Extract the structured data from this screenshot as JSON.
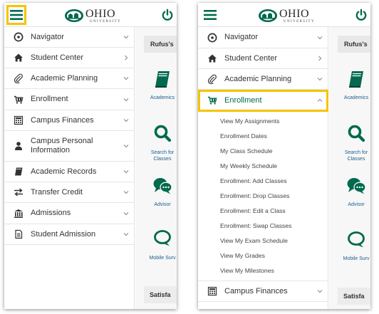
{
  "colors": {
    "brand_green": "#00694e",
    "highlight": "#f5c400",
    "link_blue": "#1b5d8f",
    "text": "#333333"
  },
  "header": {
    "logo_text": "OHIO",
    "logo_subtext": "UNIVERSITY",
    "menu_icon": "hamburger-icon",
    "power_icon": "power-icon"
  },
  "left_panel": {
    "menu": [
      {
        "label": "Navigator",
        "icon": "compass-icon",
        "chevron": "down"
      },
      {
        "label": "Student Center",
        "icon": "home-icon",
        "chevron": "right"
      },
      {
        "label": "Academic Planning",
        "icon": "paperclip-icon",
        "chevron": "down"
      },
      {
        "label": "Enrollment",
        "icon": "cart-icon",
        "chevron": "down"
      },
      {
        "label": "Campus Finances",
        "icon": "calculator-icon",
        "chevron": "down"
      },
      {
        "label_line1": "Campus Personal",
        "label_line2": "Information",
        "icon": "person-icon",
        "chevron": "down"
      },
      {
        "label": "Academic Records",
        "icon": "book-icon",
        "chevron": "down"
      },
      {
        "label": "Transfer Credit",
        "icon": "transfer-icon",
        "chevron": "down"
      },
      {
        "label": "Admissions",
        "icon": "institution-icon",
        "chevron": "down"
      },
      {
        "label": "Student Admission",
        "icon": "document-icon",
        "chevron": "down"
      }
    ],
    "content": {
      "user_card": "Rufus's",
      "tiles": [
        {
          "label": "Academics",
          "icon": "book-icon"
        },
        {
          "label_line1": "Search for",
          "label_line2": "Classes",
          "icon": "search-icon"
        },
        {
          "label": "Advisor",
          "icon": "chat-icon"
        },
        {
          "label": "Mobile Surv",
          "icon": "comment-icon"
        }
      ],
      "bottom_card": "Satisfa"
    }
  },
  "right_panel": {
    "menu_top": [
      {
        "label": "Navigator",
        "icon": "compass-icon",
        "chevron": "down"
      },
      {
        "label": "Student Center",
        "icon": "home-icon",
        "chevron": "right"
      },
      {
        "label": "Academic Planning",
        "icon": "paperclip-icon",
        "chevron": "down"
      }
    ],
    "active_item": {
      "label": "Enrollment",
      "icon": "cart-icon",
      "chevron": "up"
    },
    "submenu": [
      "View My Assignments",
      "Enrollment Dates",
      "My Class Schedule",
      "My Weekly Schedule",
      "Enrollment: Add Classes",
      "Enrollment: Drop Classes",
      "Enrollment: Edit a Class",
      "Enrollment: Swap Classes",
      "View My Exam Schedule",
      "View My Grades",
      "View My Milestones"
    ],
    "menu_bottom": [
      {
        "label": "Campus Finances",
        "icon": "calculator-icon",
        "chevron": "down"
      }
    ],
    "content": {
      "user_card": "Rufus's",
      "tiles": [
        {
          "label": "Academics",
          "icon": "book-icon"
        },
        {
          "label_line1": "Search for",
          "label_line2": "Classes",
          "icon": "search-icon"
        },
        {
          "label": "Advisor",
          "icon": "chat-icon"
        },
        {
          "label": "Mobile Surv",
          "icon": "comment-icon"
        }
      ],
      "bottom_card": "Satisfa"
    }
  }
}
